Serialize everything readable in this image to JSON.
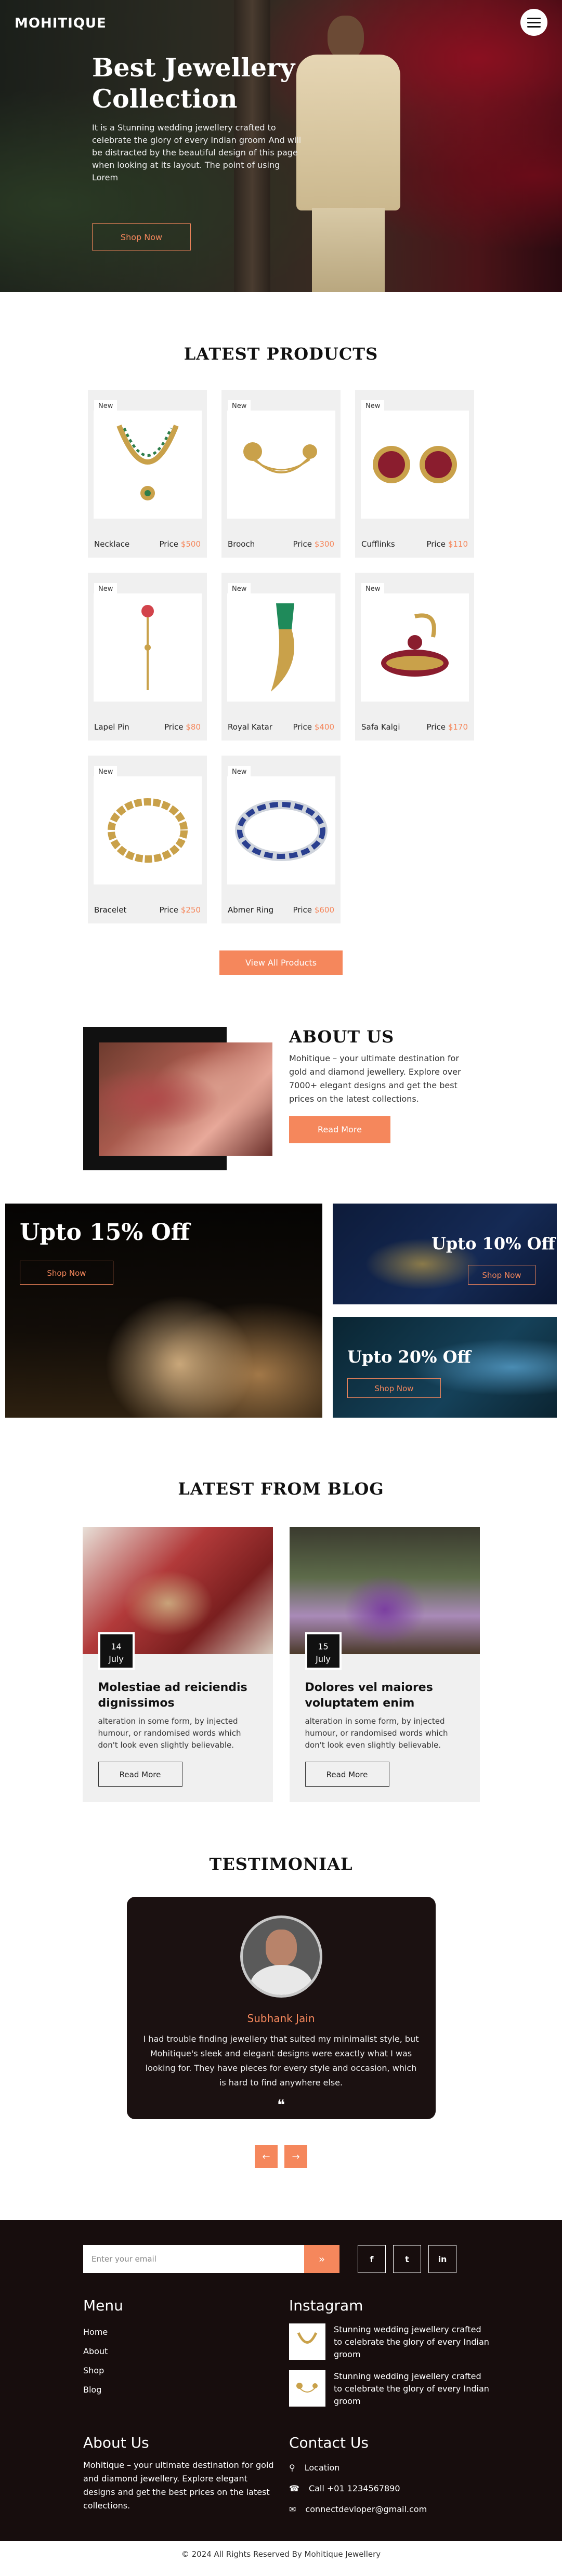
{
  "header": {
    "logo": "MOHITIQUE",
    "menu_icon": "hamburger-menu-icon"
  },
  "hero": {
    "title": "Best Jewellery Collection",
    "description": "It is a Stunning wedding jewellery crafted to celebrate the glory of every Indian groom And will be distracted by the beautiful design of this page when looking at its layout. The point of using Lorem",
    "cta": "Shop Now"
  },
  "products": {
    "title": "LATEST PRODUCTS",
    "badge": "New",
    "price_label": "Price",
    "items": [
      {
        "name": "Necklace",
        "price": "$500"
      },
      {
        "name": "Brooch",
        "price": "$300"
      },
      {
        "name": "Cufflinks",
        "price": "$110"
      },
      {
        "name": "Lapel Pin",
        "price": "$80"
      },
      {
        "name": "Royal Katar",
        "price": "$400"
      },
      {
        "name": "Safa Kalgi",
        "price": "$170"
      },
      {
        "name": "Bracelet",
        "price": "$250"
      },
      {
        "name": "Abmer Ring",
        "price": "$600"
      }
    ],
    "view_all": "View All Products"
  },
  "about": {
    "title": "ABOUT US",
    "text": "Mohitique – your ultimate destination for gold and diamond jewellery. Explore over 7000+ elegant designs and get the best prices on the latest collections.",
    "cta": "Read More"
  },
  "offers": {
    "big": {
      "title": "Upto 15% Off",
      "cta": "Shop Now"
    },
    "small1": {
      "title": "Upto 10% Off",
      "cta": "Shop Now"
    },
    "small2": {
      "title": "Upto 20% Off",
      "cta": "Shop Now"
    }
  },
  "blog": {
    "title": "LATEST FROM BLOG",
    "posts": [
      {
        "day": "14",
        "month": "July",
        "title": "Molestiae ad reiciendis dignissimos",
        "text": "alteration in some form, by injected humour, or randomised words which don't look even slightly believable.",
        "cta": "Read More"
      },
      {
        "day": "15",
        "month": "July",
        "title": "Dolores vel maiores voluptatem enim",
        "text": "alteration in some form, by injected humour, or randomised words which don't look even slightly believable.",
        "cta": "Read More"
      }
    ]
  },
  "testimonial": {
    "title": "TESTIMONIAL",
    "name": "Subhank Jain",
    "text": "I had trouble finding jewellery that suited my minimalist style, but Mohitique's sleek and elegant designs were exactly what I was looking for. They have pieces for every style and occasion, which is hard to find anywhere else.",
    "quote_glyph": "❝",
    "prev": "←",
    "next": "→"
  },
  "footer": {
    "newsletter_placeholder": "Enter your email",
    "newsletter_button": "»",
    "social": [
      "f",
      "t",
      "in"
    ],
    "menu": {
      "title": "Menu",
      "items": [
        "Home",
        "About",
        "Shop",
        "Blog"
      ]
    },
    "instagram": {
      "title": "Instagram",
      "items": [
        {
          "text": "Stunning wedding jewellery crafted to celebrate the glory of every Indian groom"
        },
        {
          "text": "Stunning wedding jewellery crafted to celebrate the glory of every Indian groom"
        }
      ]
    },
    "about": {
      "title": "About Us",
      "text": "Mohitique – your ultimate destination for gold and diamond jewellery. Explore elegant designs and get the best prices on the latest collections."
    },
    "contact": {
      "title": "Contact Us",
      "items": [
        {
          "icon": "location-pin-icon",
          "text": "Location"
        },
        {
          "icon": "phone-icon",
          "text": "Call +01 1234567890"
        },
        {
          "icon": "email-icon",
          "text": "connectdevloper@gmail.com"
        }
      ]
    },
    "copyright": "© 2024 All Rights Reserved By Mohitique Jewellery"
  },
  "colors": {
    "accent": "#f5875c",
    "dark": "#170d0d",
    "card_bg": "#f0f0f0"
  }
}
